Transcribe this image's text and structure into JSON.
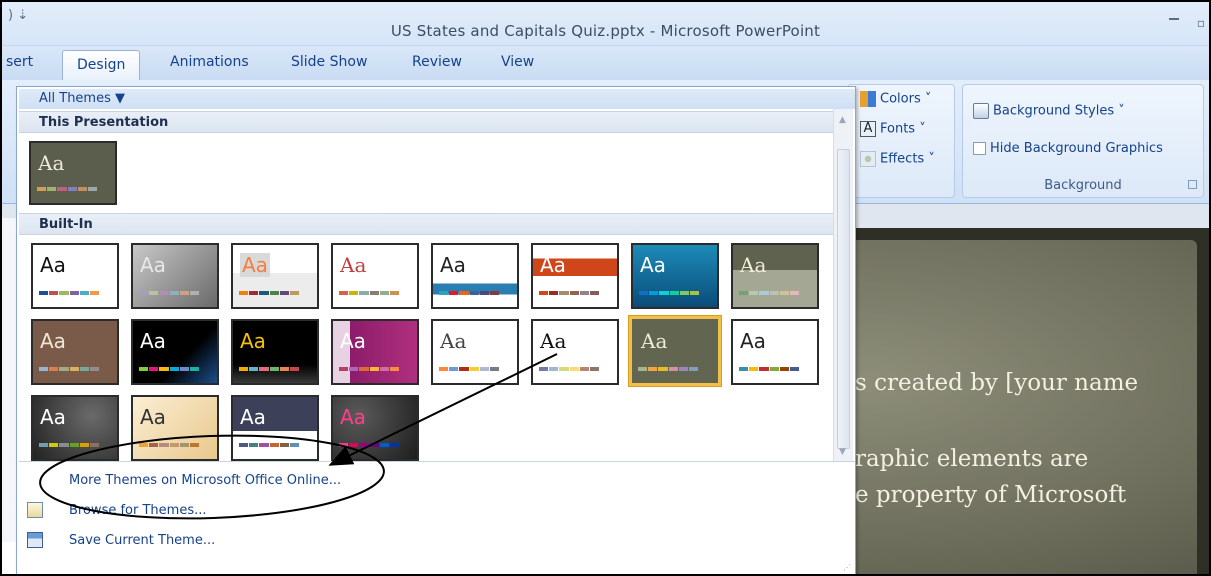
{
  "window": {
    "title": "US States and Capitals Quiz.pptx - Microsoft PowerPoint",
    "qat_glyph": ") ⇣"
  },
  "tabs": [
    {
      "label": "sert"
    },
    {
      "label": "Design"
    },
    {
      "label": "Animations"
    },
    {
      "label": "Slide Show"
    },
    {
      "label": "Review"
    },
    {
      "label": "View"
    }
  ],
  "ribbon": {
    "colors_label": "Colors ˅",
    "fonts_label": "Fonts ˅",
    "effects_label": "Effects ˅",
    "background_styles_label": "Background Styles ˅",
    "hide_bg_graphics_label": "Hide Background Graphics",
    "background_group_label": "Background"
  },
  "gallery": {
    "all_themes_label": "All Themes ▼",
    "this_presentation_heading": "This Presentation",
    "builtin_heading": "Built-In",
    "aa_text": "Aa",
    "menu": {
      "more_themes": "More Themes on Microsoft Office Online...",
      "browse_themes": "Browse for Themes...",
      "save_theme": "Save Current Theme..."
    }
  },
  "slide": {
    "line1": "s created by [your name",
    "line2": "raphic elements are",
    "line3": "e property of Microsoft"
  },
  "colors": {
    "ribbon_text": "#15428b",
    "selected_border": "#f3bf4b"
  }
}
